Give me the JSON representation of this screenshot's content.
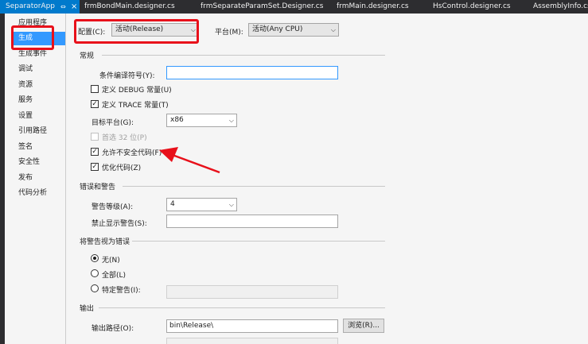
{
  "tabs": [
    {
      "label": "SeparatorApp",
      "pin": "⇔",
      "close": "×"
    },
    {
      "label": "frmBondMain.designer.cs"
    },
    {
      "label": "frmSeparateParamSet.Designer.cs"
    },
    {
      "label": "frmMain.designer.cs"
    },
    {
      "label": "HsControl.designer.cs"
    },
    {
      "label": "AssemblyInfo.cs"
    }
  ],
  "sidebar": {
    "items": [
      {
        "label": "应用程序"
      },
      {
        "label": "生成"
      },
      {
        "label": "生成事件"
      },
      {
        "label": "调试"
      },
      {
        "label": "资源"
      },
      {
        "label": "服务"
      },
      {
        "label": "设置"
      },
      {
        "label": "引用路径"
      },
      {
        "label": "签名"
      },
      {
        "label": "安全性"
      },
      {
        "label": "发布"
      },
      {
        "label": "代码分析"
      }
    ],
    "selected_index": 1
  },
  "header": {
    "config_label": "配置(C):",
    "config_value": "活动(Release)",
    "platform_label": "平台(M):",
    "platform_value": "活动(Any CPU)"
  },
  "general": {
    "title": "常规",
    "symbols_label": "条件编译符号(Y):",
    "symbols_value": "",
    "define_debug": {
      "label": "定义 DEBUG 常量(U)",
      "checked": false
    },
    "define_trace": {
      "label": "定义 TRACE 常量(T)",
      "checked": true
    },
    "target_label": "目标平台(G):",
    "target_value": "x86",
    "prefer32": {
      "label": "首选 32 位(P)",
      "checked": false,
      "enabled": false
    },
    "unsafe": {
      "label": "允许不安全代码(F)",
      "checked": true
    },
    "optimize": {
      "label": "优化代码(Z)",
      "checked": true
    }
  },
  "errors": {
    "title": "错误和警告",
    "warn_level_label": "警告等级(A):",
    "warn_level_value": "4",
    "suppress_label": "禁止显示警告(S):",
    "suppress_value": ""
  },
  "treat": {
    "title": "将警告视为错误",
    "options": [
      {
        "label": "无(N)",
        "selected": true
      },
      {
        "label": "全部(L)",
        "selected": false
      },
      {
        "label": "特定警告(I):",
        "selected": false
      }
    ],
    "specific_value": ""
  },
  "output": {
    "title": "输出",
    "path_label": "输出路径(O):",
    "path_value": "bin\\Release\\",
    "browse_label": "浏览(R)..."
  },
  "glyphs": {
    "check": "✓",
    "combo_arrow": "⌵"
  },
  "colors": {
    "accent": "#007acc",
    "selection": "#3399ff",
    "annotation_red": "#e8101a"
  }
}
